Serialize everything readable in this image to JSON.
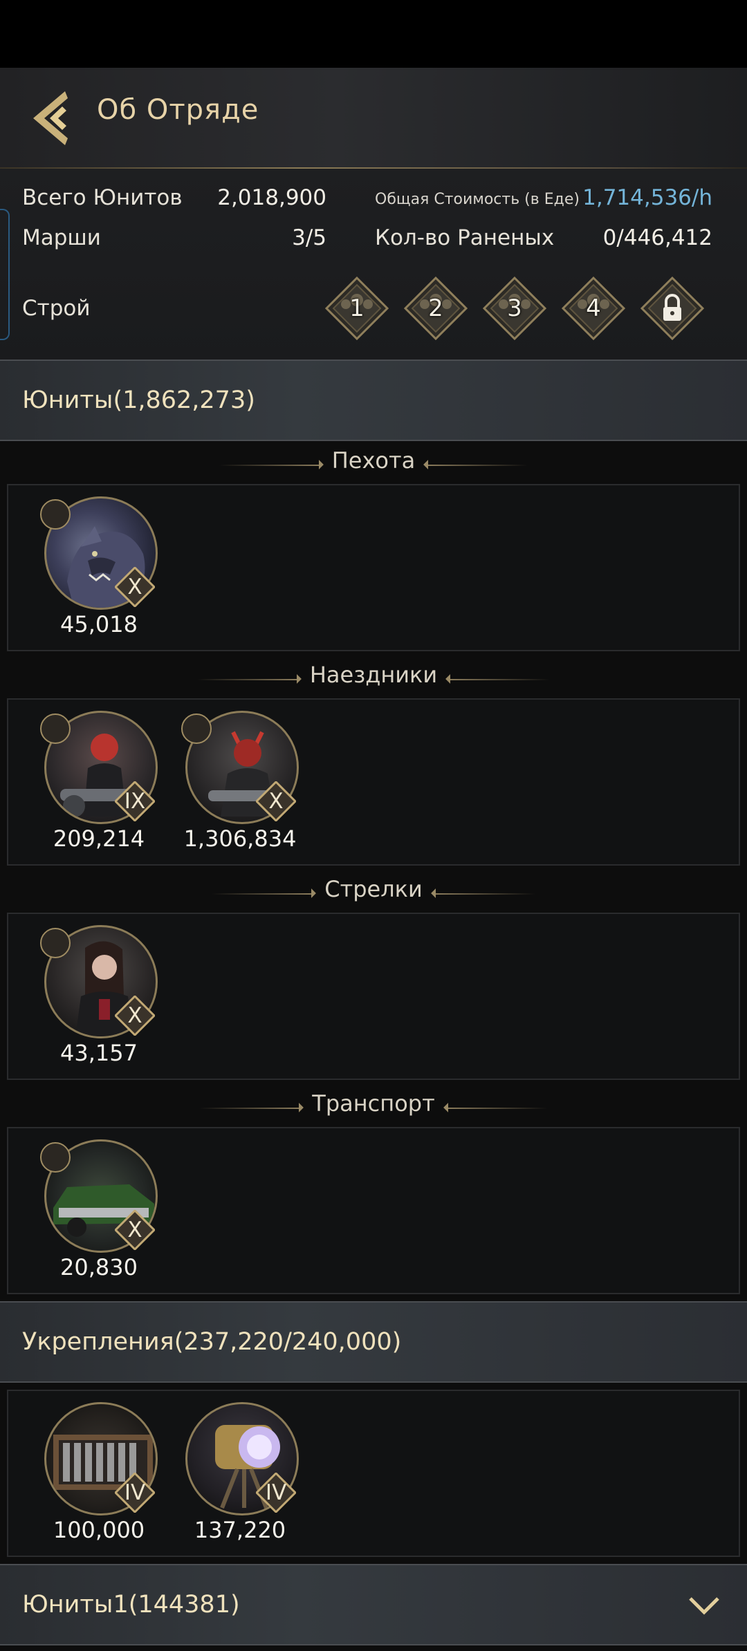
{
  "header": {
    "title": "Об Отряде"
  },
  "stats": {
    "total_units_label": "Всего Юнитов",
    "total_units_value": "2,018,900",
    "total_cost_label": "Общая Стоимость (в Еде)",
    "total_cost_value": "1,714,536/h",
    "marches_label": "Марши",
    "marches_value": "3/5",
    "wounded_label": "Кол-во Раненых",
    "wounded_value": "0/446,412",
    "formation_label": "Строй",
    "formations": [
      "1",
      "2",
      "3",
      "4"
    ]
  },
  "units_group": {
    "label": "Юниты(1,862,273)"
  },
  "sections": {
    "infantry": {
      "title": "Пехота",
      "units": [
        {
          "tier": "X",
          "count": "45,018"
        }
      ]
    },
    "riders": {
      "title": "Наездники",
      "units": [
        {
          "tier": "IX",
          "count": "209,214"
        },
        {
          "tier": "X",
          "count": "1,306,834"
        }
      ]
    },
    "shooters": {
      "title": "Стрелки",
      "units": [
        {
          "tier": "X",
          "count": "43,157"
        }
      ]
    },
    "transport": {
      "title": "Транспорт",
      "units": [
        {
          "tier": "X",
          "count": "20,830"
        }
      ]
    }
  },
  "fortifications_group": {
    "label": "Укрепления(237,220/240,000)",
    "units": [
      {
        "tier": "IV",
        "count": "100,000"
      },
      {
        "tier": "IV",
        "count": "137,220"
      }
    ]
  },
  "units1_group": {
    "label": "Юниты1(144381)"
  },
  "colors": {
    "accent_blue": "#74b4d8",
    "gold": "#e7d3a8"
  }
}
